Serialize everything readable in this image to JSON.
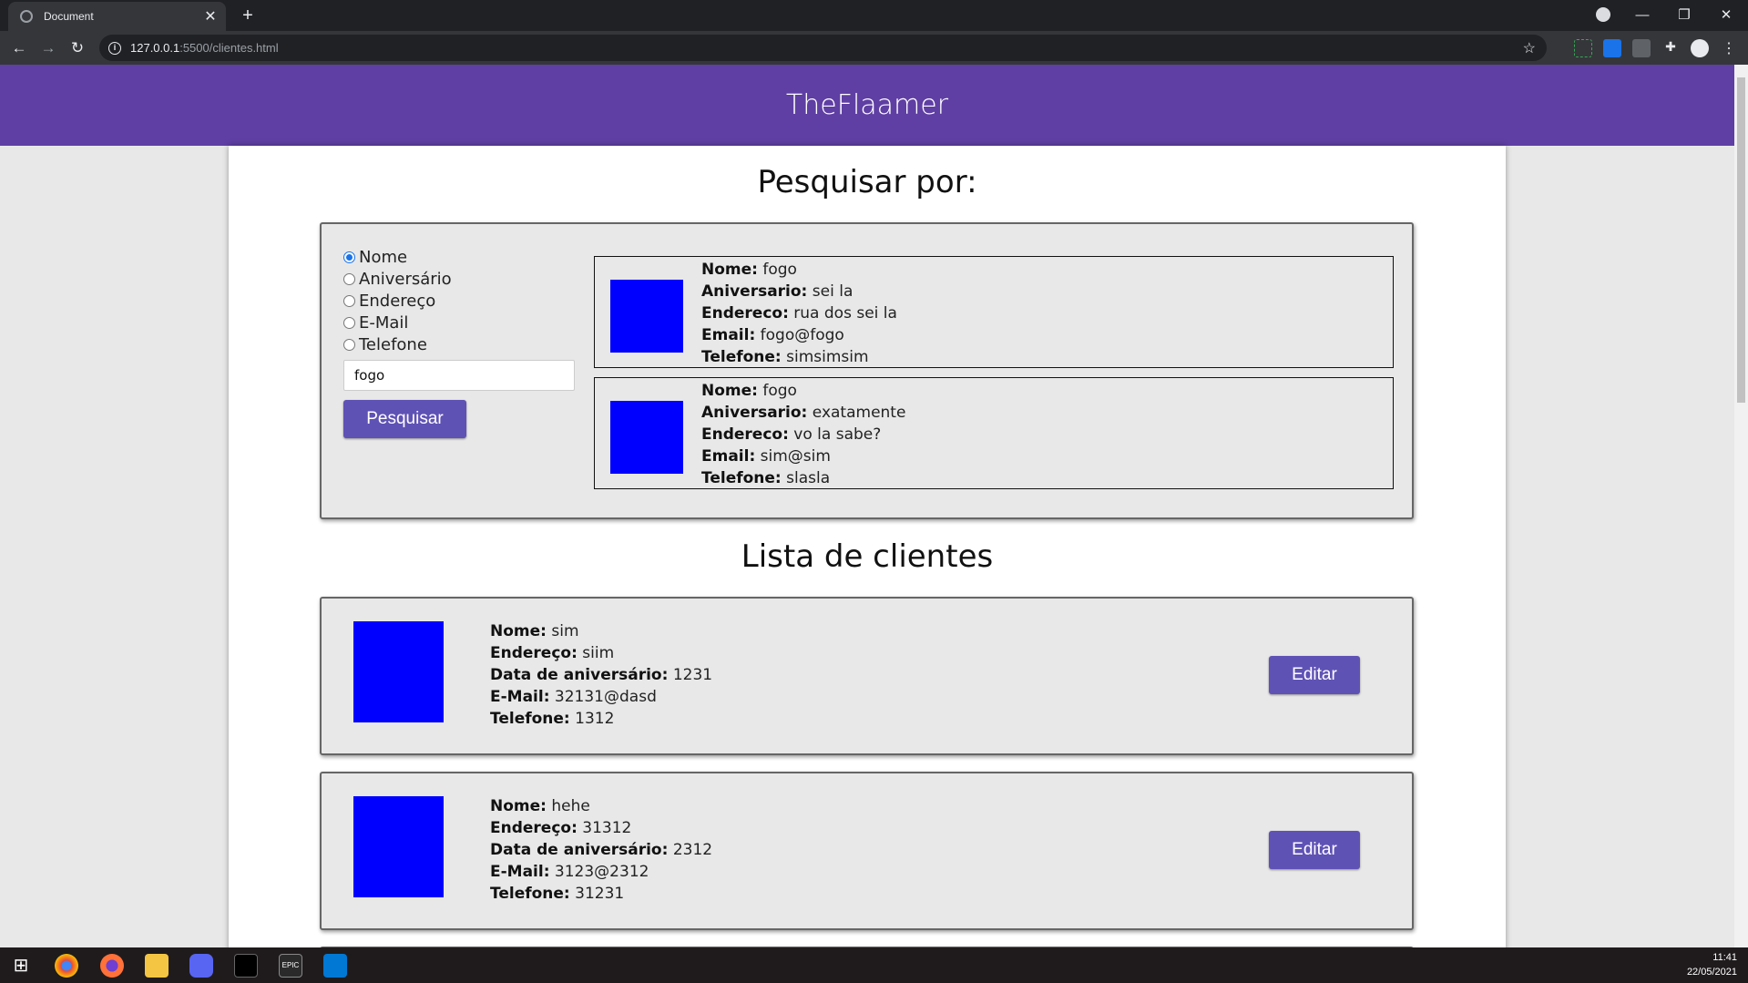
{
  "browser": {
    "tab_title": "Document",
    "url_host": "127.0.0.1",
    "url_path": ":5500/clientes.html"
  },
  "header": {
    "brand": "TheFlaamer"
  },
  "search": {
    "title": "Pesquisar por:",
    "options": [
      "Nome",
      "Aniversário",
      "Endereço",
      "E-Mail",
      "Telefone"
    ],
    "selected": "Nome",
    "input_value": "fogo",
    "button_label": "Pesquisar",
    "results": [
      {
        "nome_label": "Nome:",
        "nome": "fogo",
        "aniv_label": "Aniversario:",
        "aniv": "sei la",
        "end_label": "Endereco:",
        "end": "rua dos sei la",
        "email_label": "Email:",
        "email": "fogo@fogo",
        "tel_label": "Telefone:",
        "tel": "simsimsim"
      },
      {
        "nome_label": "Nome:",
        "nome": "fogo",
        "aniv_label": "Aniversario:",
        "aniv": "exatamente",
        "end_label": "Endereco:",
        "end": "vo la sabe?",
        "email_label": "Email:",
        "email": "sim@sim",
        "tel_label": "Telefone:",
        "tel": "slasla"
      }
    ]
  },
  "clients": {
    "title": "Lista de clientes",
    "edit_label": "Editar",
    "items": [
      {
        "nome_label": "Nome:",
        "nome": "sim",
        "end_label": "Endereço:",
        "end": "siim",
        "data_label": "Data de aniversário:",
        "data": "1231",
        "email_label": "E-Mail:",
        "email": "32131@dasd",
        "tel_label": "Telefone:",
        "tel": "1312"
      },
      {
        "nome_label": "Nome:",
        "nome": "hehe",
        "end_label": "Endereço:",
        "end": "31312",
        "data_label": "Data de aniversário:",
        "data": "2312",
        "email_label": "E-Mail:",
        "email": "3123@2312",
        "tel_label": "Telefone:",
        "tel": "31231"
      }
    ]
  },
  "taskbar": {
    "time": "11:41",
    "date": "22/05/2021"
  },
  "colors": {
    "header": "#5f3fa3",
    "button": "#5f52b5",
    "avatar": "#0000ff",
    "panel": "#e8e8e8"
  }
}
